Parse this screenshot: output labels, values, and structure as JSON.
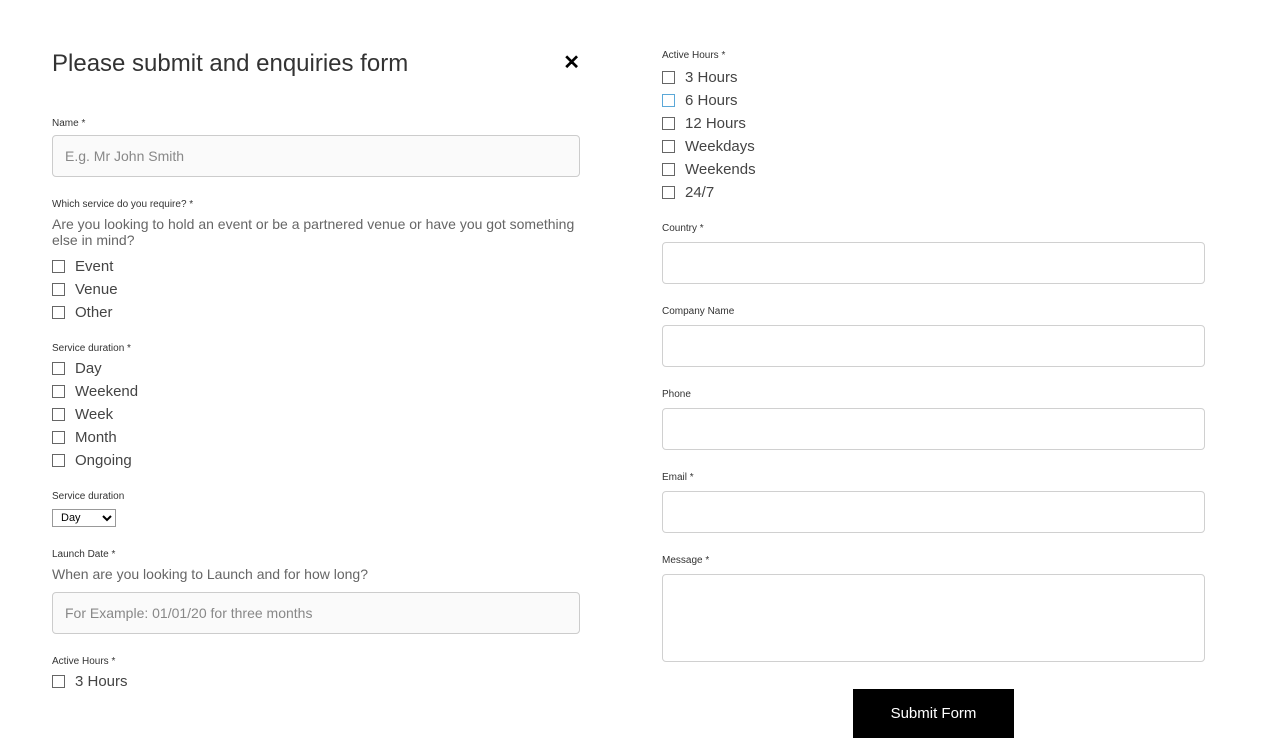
{
  "modal": {
    "title": "Please submit and enquiries form"
  },
  "form": {
    "name": {
      "label": "Name *",
      "placeholder": "E.g. Mr John Smith"
    },
    "service": {
      "label": "Which service do you require? *",
      "sublabel": "Are you looking to hold an event or be a partnered venue or have you got something else in mind?",
      "options": [
        {
          "label": "Event"
        },
        {
          "label": "Venue"
        },
        {
          "label": "Other"
        }
      ]
    },
    "duration": {
      "label": "Service duration *",
      "options": [
        {
          "label": "Day"
        },
        {
          "label": "Weekend"
        },
        {
          "label": "Week"
        },
        {
          "label": "Month"
        },
        {
          "label": "Ongoing"
        }
      ]
    },
    "duration_select": {
      "label": "Service duration",
      "selected": "Day"
    },
    "launch": {
      "label": "Launch Date *",
      "sublabel": "When are you looking to Launch and for how long?",
      "placeholder": "For Example: 01/01/20 for three months"
    },
    "active_hours_left": {
      "label": "Active Hours *",
      "options": [
        {
          "label": "3 Hours"
        }
      ]
    },
    "active_hours_right": {
      "label": "Active Hours *",
      "options": [
        {
          "label": "3 Hours",
          "highlighted": false
        },
        {
          "label": "6 Hours",
          "highlighted": true
        },
        {
          "label": "12 Hours",
          "highlighted": false
        },
        {
          "label": "Weekdays",
          "highlighted": false
        },
        {
          "label": "Weekends",
          "highlighted": false
        },
        {
          "label": "24/7",
          "highlighted": false
        }
      ]
    },
    "country": {
      "label": "Country *"
    },
    "company": {
      "label": "Company Name"
    },
    "phone": {
      "label": "Phone"
    },
    "email": {
      "label": "Email *"
    },
    "message": {
      "label": "Message *"
    },
    "submit": "Submit Form"
  }
}
